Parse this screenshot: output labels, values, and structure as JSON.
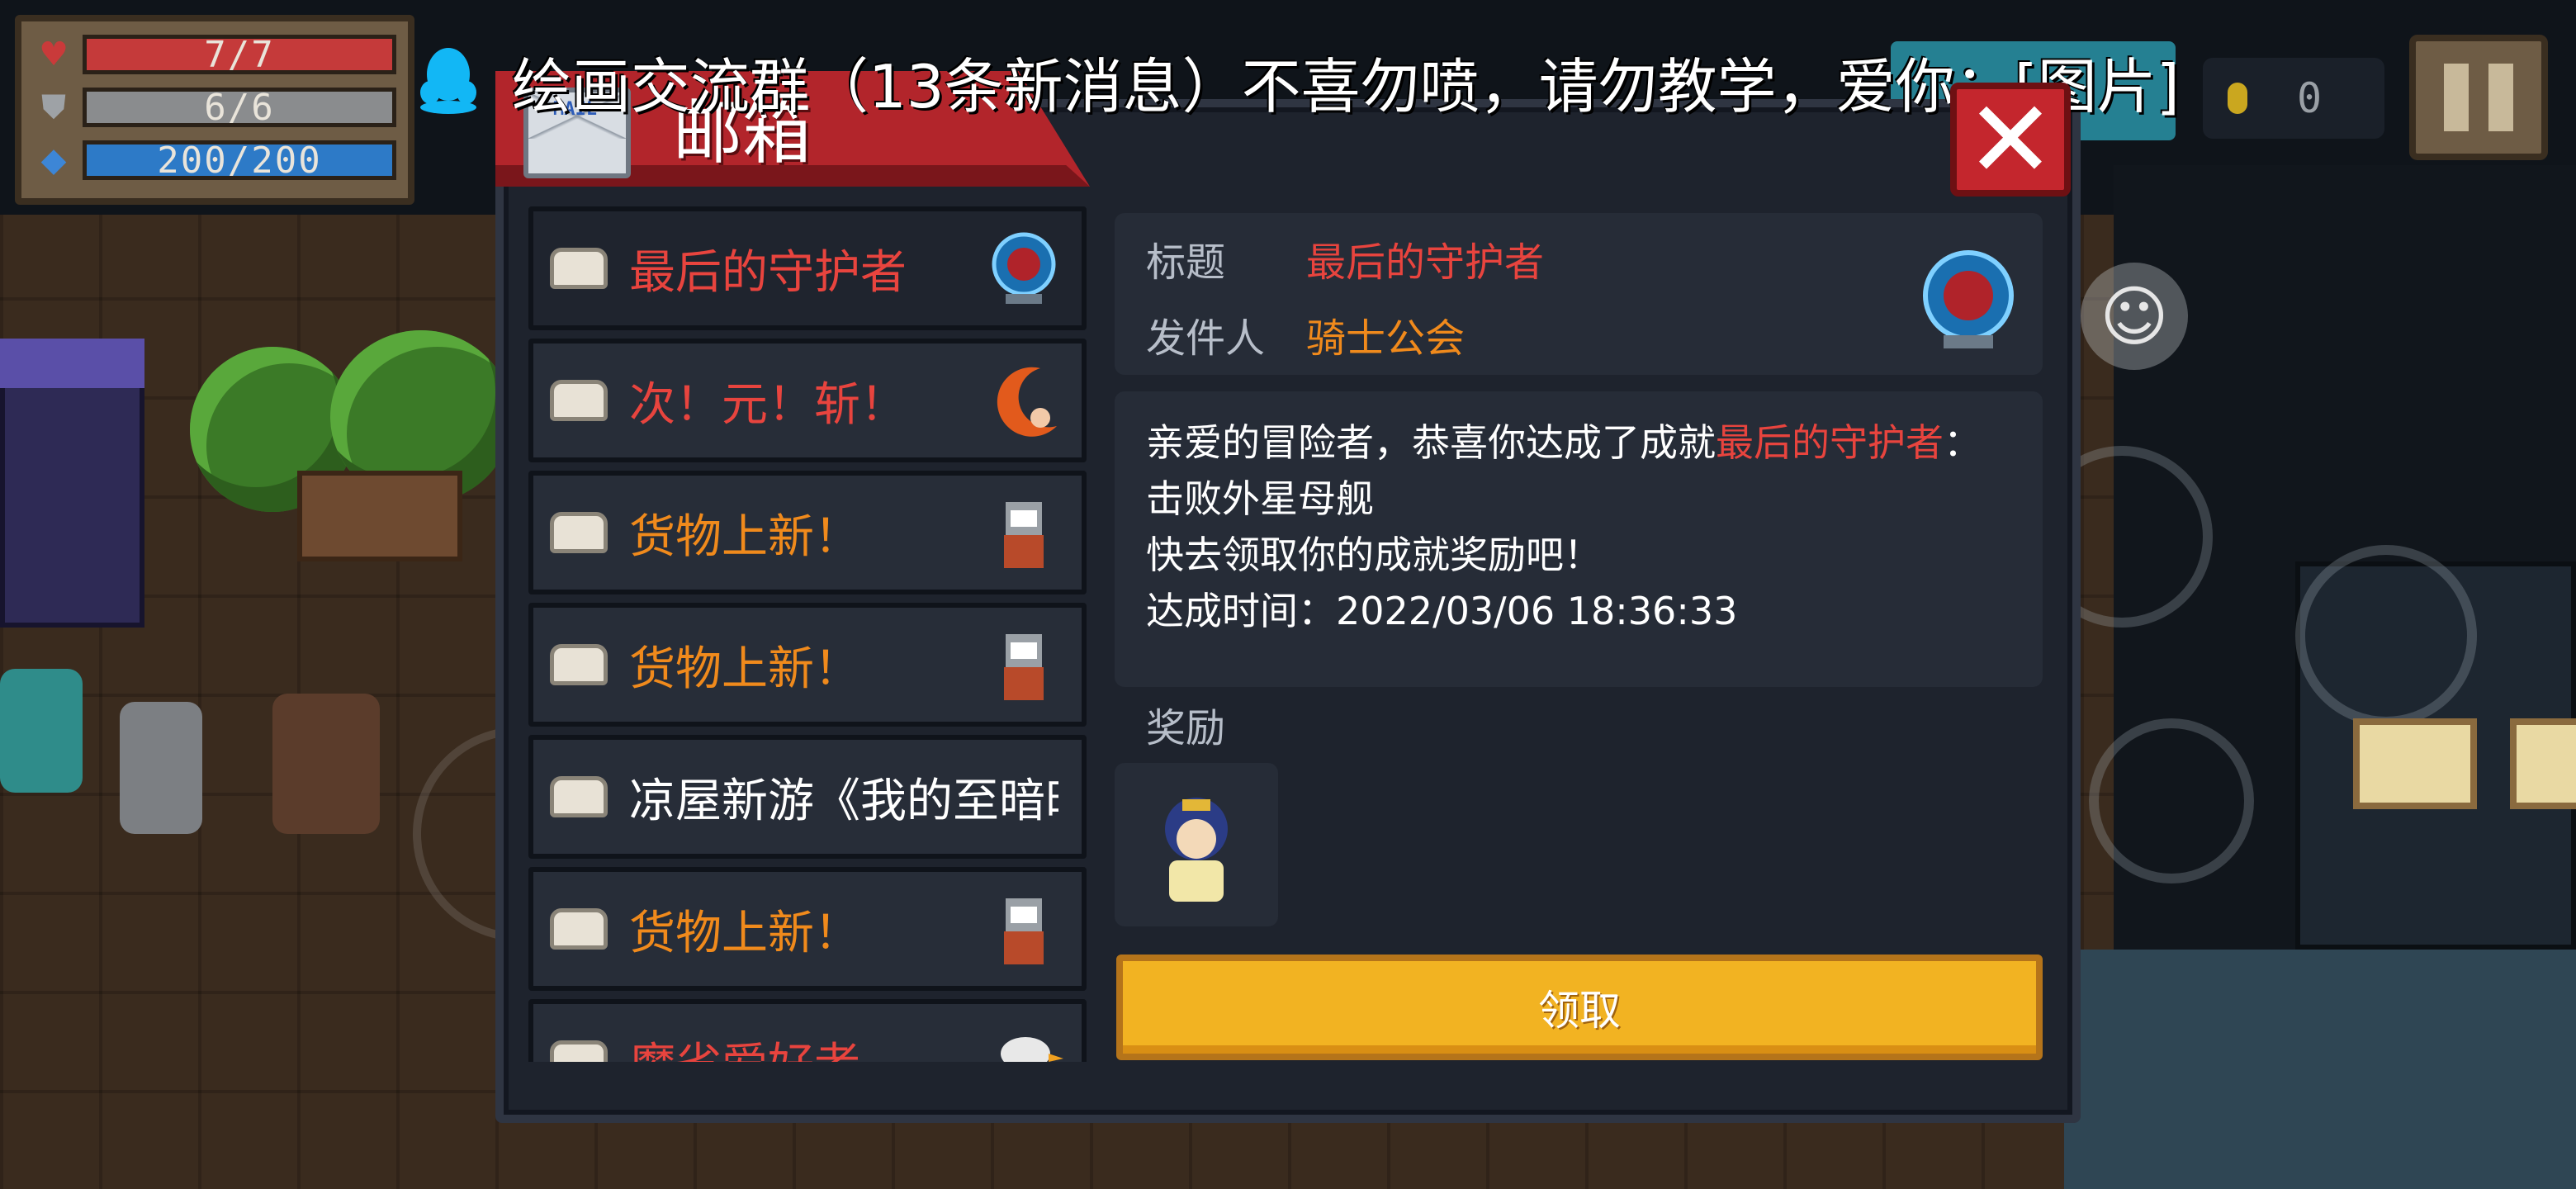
{
  "hud": {
    "hp": "7/7",
    "armor": "6/6",
    "energy": "200/200",
    "coins": "0"
  },
  "notification": {
    "text": "绘画交流群（13条新消息）不喜勿喷，请勿教学，爱你：[图片]"
  },
  "mailbox": {
    "title": "邮箱",
    "envelope_text": "MAIL",
    "close_label": "✕",
    "items": [
      {
        "label": "最后的守护者",
        "color": "#e8443e",
        "thumb": "orb-icon"
      },
      {
        "label": "次！元！斩！",
        "color": "#e8443e",
        "thumb": "crescent-blade-icon"
      },
      {
        "label": "货物上新！",
        "color": "#f08a1c",
        "thumb": "merchant-cat-icon"
      },
      {
        "label": "货物上新！",
        "color": "#f08a1c",
        "thumb": "merchant-cat-icon"
      },
      {
        "label": "凉屋新游《我的至暗时",
        "color": "#ffffff",
        "thumb": ""
      },
      {
        "label": "货物上新！",
        "color": "#f08a1c",
        "thumb": "merchant-cat-icon"
      },
      {
        "label": "魔省爱好者",
        "color": "#e8443e",
        "thumb": "bird-icon"
      }
    ],
    "detail": {
      "subject_label": "标题",
      "subject_value": "最后的守护者",
      "sender_label": "发件人",
      "sender_value": "骑士公会",
      "body_prefix": "亲爱的冒险者，恭喜你达成了成就",
      "body_highlight": "最后的守护者",
      "body_suffix": "：",
      "body_line2": "击败外星母舰",
      "body_line3": "快去领取你的成就奖励吧！",
      "body_line4": "达成时间：2022/03/06 18:36:33",
      "reward_label": "奖励",
      "claim_label": "领取"
    }
  },
  "colors": {
    "accent_red": "#e8443e",
    "accent_orange": "#f08a1c",
    "claim_yellow": "#f2b322",
    "header_red": "#b2252b"
  }
}
